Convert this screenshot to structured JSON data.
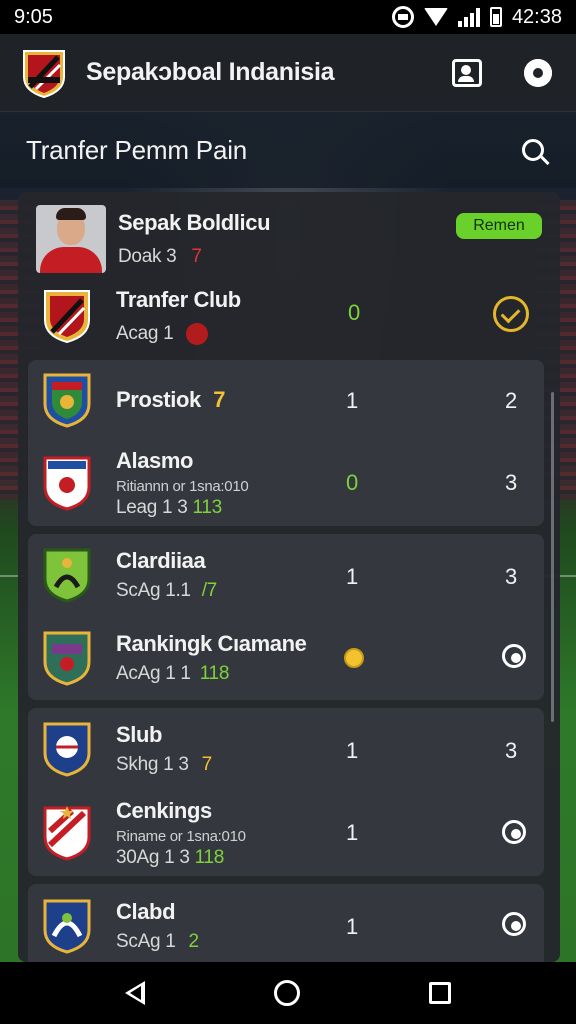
{
  "status": {
    "time_left": "9:05",
    "time_right": "42:38"
  },
  "appbar": {
    "title": "Sepakɔboal Indanisia",
    "logo_icon": "club-crest-icon",
    "profile_icon": "profile-card-icon",
    "settings_icon": "gear-icon"
  },
  "section": {
    "title": "Tranfer Pemm Pain",
    "search_icon": "search-icon"
  },
  "featured": {
    "player": {
      "name": "Sepak Boldlicu",
      "sub_prefix": "Doak 3",
      "sub_accent": "7",
      "badge": "Remen"
    },
    "club": {
      "name": "Tranfer Club",
      "sub": "Acag 1",
      "value": "0"
    }
  },
  "cards": [
    {
      "rows": [
        {
          "name": "Prostiok",
          "accent": "7",
          "col_a": "1",
          "col_b": "2"
        },
        {
          "name": "Alasmo",
          "line2": "Ritiannn or 1sna:010",
          "line3_prefix": "Leag 1 3",
          "line3_accent": "113",
          "col_a": "0",
          "col_b": "3"
        }
      ]
    },
    {
      "rows": [
        {
          "name": "Clardiiaa",
          "sub_prefix": "ScAg 1.1",
          "sub_accent": "/7",
          "col_a": "1",
          "col_b": "3"
        },
        {
          "name": "Rankingk Cıamane",
          "sub_prefix": "AcAg 1 1",
          "sub_accent": "118"
        }
      ]
    },
    {
      "rows": [
        {
          "name": "Slub",
          "sub_prefix": "Skhg 1 3",
          "sub_accent": "7",
          "col_a": "1",
          "col_b": "3"
        },
        {
          "name": "Cenkings",
          "line2": "Riname or 1sna:010",
          "line3_prefix": "30Ag 1 3",
          "line3_accent": "118",
          "col_a": "1"
        }
      ]
    },
    {
      "rows": [
        {
          "name": "Clabd",
          "sub_prefix": "ScAg 1",
          "sub_accent": "2",
          "col_a": "1"
        }
      ]
    }
  ],
  "colors": {
    "accent_green": "#6ad12b",
    "accent_red": "#e23535",
    "accent_yellow": "#f2c230",
    "panel": "#24262c",
    "card": "#34373e"
  },
  "nav": {
    "back_icon": "back-triangle-icon",
    "home_icon": "home-circle-icon",
    "recents_icon": "recents-square-icon"
  }
}
